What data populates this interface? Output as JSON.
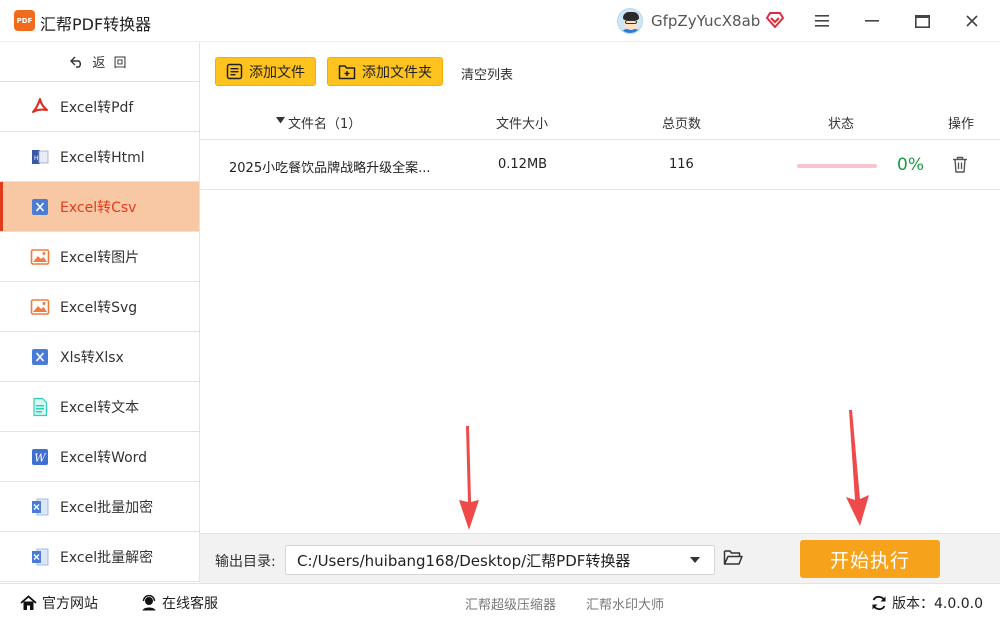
{
  "app": {
    "title": "汇帮PDF转换器",
    "logo_text": "PDF",
    "username": "GfpZyYucX8ab"
  },
  "sidebar": {
    "back_label": "返 回",
    "items": [
      {
        "label": "Excel转Pdf",
        "icon": "pdf-icon"
      },
      {
        "label": "Excel转Html",
        "icon": "html-icon"
      },
      {
        "label": "Excel转Csv",
        "icon": "csv-icon",
        "active": true
      },
      {
        "label": "Excel转图片",
        "icon": "image-icon"
      },
      {
        "label": "Excel转Svg",
        "icon": "svg-image-icon"
      },
      {
        "label": "Xls转Xlsx",
        "icon": "excel-x-icon"
      },
      {
        "label": "Excel转文本",
        "icon": "text-doc-icon"
      },
      {
        "label": "Excel转Word",
        "icon": "word-icon"
      },
      {
        "label": "Excel批量加密",
        "icon": "excel-lock-icon"
      },
      {
        "label": "Excel批量解密",
        "icon": "excel-unlock-icon"
      }
    ]
  },
  "toolbar": {
    "add_file": "添加文件",
    "add_folder": "添加文件夹",
    "clear_list": "清空列表"
  },
  "table": {
    "columns": {
      "name": "文件名（1）",
      "size": "文件大小",
      "pages": "总页数",
      "status": "状态",
      "action": "操作"
    },
    "rows": [
      {
        "name": "2025小吃餐饮品牌战略升级全案...",
        "size": "0.12MB",
        "pages": "116",
        "progress": 0,
        "progress_text": "0%"
      }
    ]
  },
  "output": {
    "label": "输出目录:",
    "path": "C:/Users/huibang168/Desktop/汇帮PDF转换器",
    "start_label": "开始执行"
  },
  "footer": {
    "website": "官方网站",
    "support": "在线客服",
    "link1": "汇帮超级压缩器",
    "link2": "汇帮水印大师",
    "version": "版本：4.0.0.0"
  },
  "colors": {
    "accent_yellow": "#ffc320",
    "start_orange": "#f7a21b",
    "active_bg": "#f8c8a4",
    "active_text": "#e03c1c",
    "progress_green": "#1a9c3e",
    "arrow_red": "#ee4a4a"
  }
}
